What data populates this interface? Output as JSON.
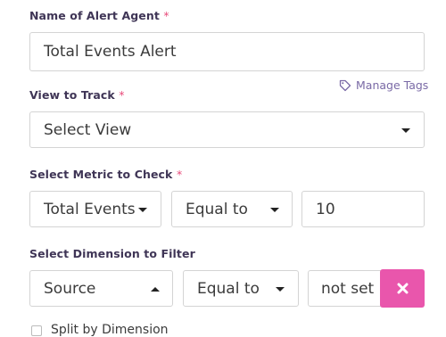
{
  "agent_name": {
    "label": "Name of Alert Agent",
    "required_mark": "*",
    "value": "Total Events Alert"
  },
  "manage_tags": {
    "label": "Manage Tags",
    "icon": "tag-icon"
  },
  "view": {
    "label": "View to Track",
    "required_mark": "*",
    "selected": "Select View"
  },
  "metric": {
    "label": "Select Metric to Check",
    "required_mark": "*",
    "metric_selected": "Total Events",
    "operator_selected": "Equal to",
    "value": "10"
  },
  "dimension": {
    "label": "Select Dimension to Filter",
    "dimension_selected": "Source",
    "operator_selected": "Equal to",
    "value": "not set",
    "remove_icon": "close-icon",
    "remove_button_color": "#e956ac"
  },
  "split": {
    "label": "Split by Dimension",
    "checked": false
  }
}
